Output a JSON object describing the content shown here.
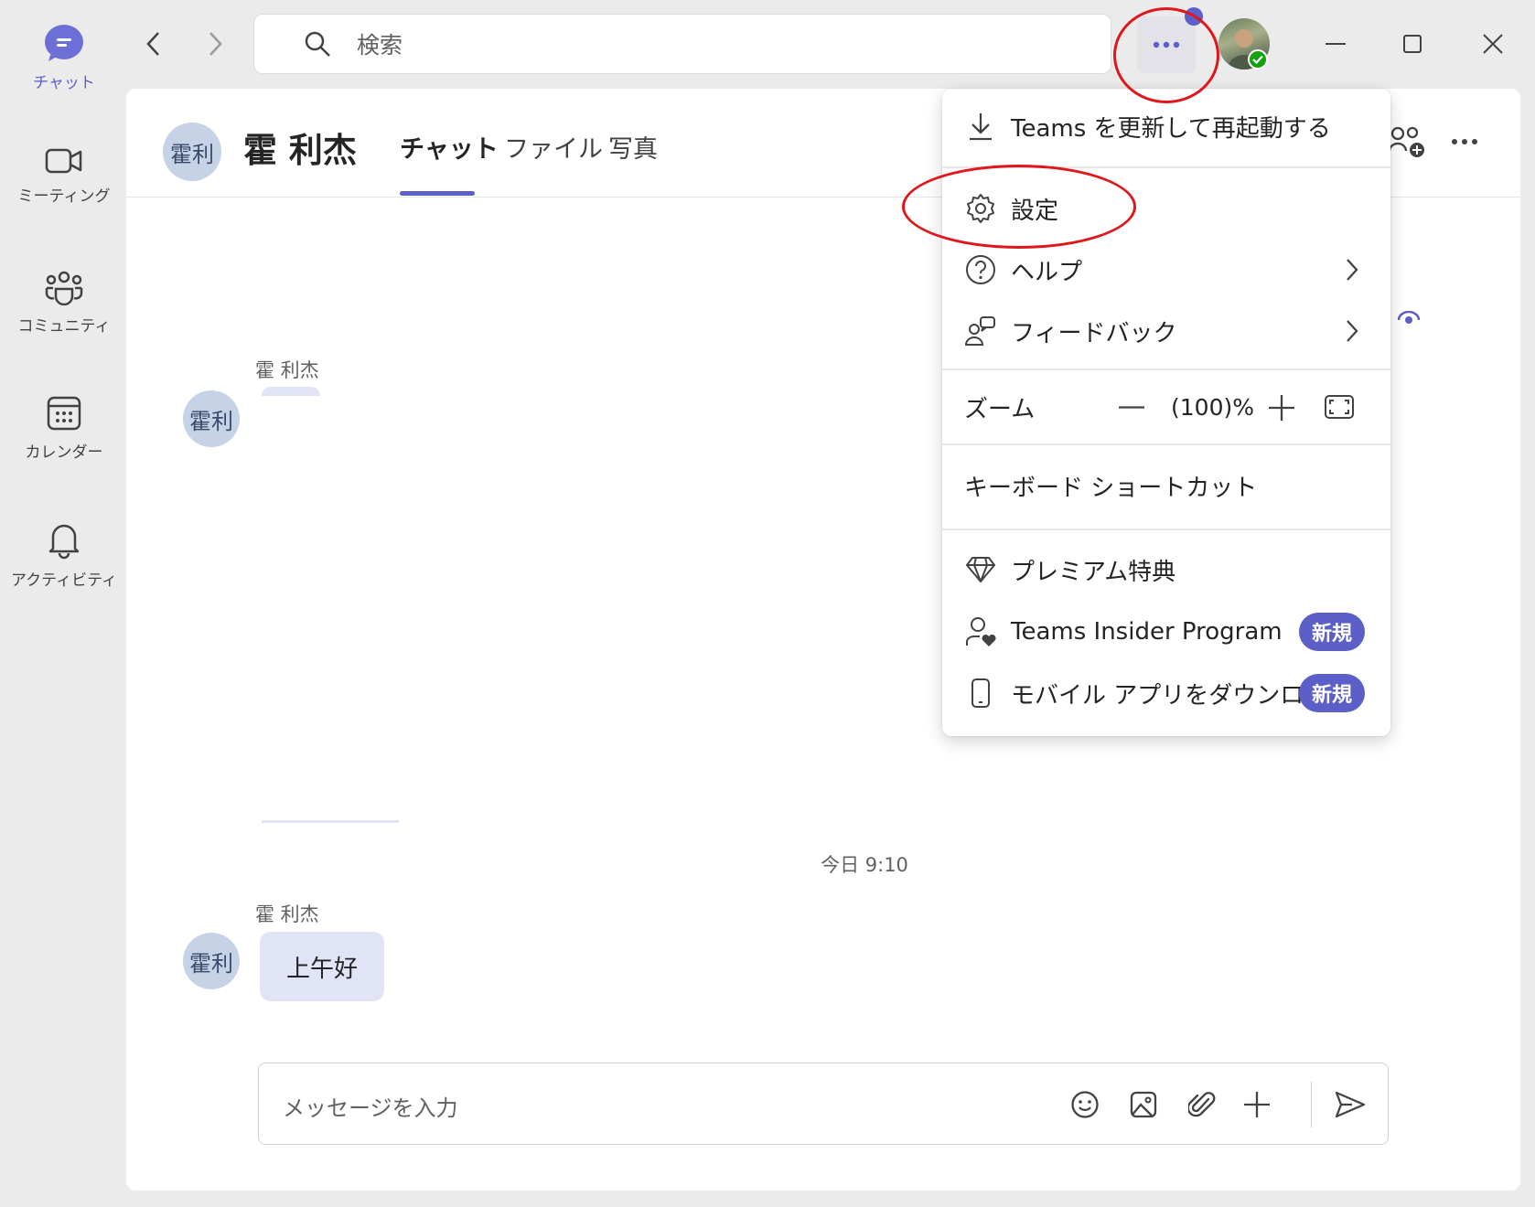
{
  "rail": {
    "items": [
      {
        "label": "チャット",
        "icon": "chat-icon",
        "active": true
      },
      {
        "label": "ミーティング",
        "icon": "video-icon"
      },
      {
        "label": "コミュニティ",
        "icon": "community-icon"
      },
      {
        "label": "カレンダー",
        "icon": "calendar-icon"
      },
      {
        "label": "アクティビティ",
        "icon": "bell-icon"
      }
    ]
  },
  "titlebar": {
    "search_placeholder": "検索"
  },
  "chat": {
    "avatar_initials": "霍利",
    "name": "霍 利杰",
    "tabs": [
      "チャット",
      "ファイル",
      "写真"
    ],
    "messages": [
      {
        "sender": "霍 利杰",
        "avatar": "霍利",
        "text": ""
      },
      {
        "sender": "霍 利杰",
        "avatar": "霍利",
        "text": "上午好"
      }
    ],
    "timestamp": "今日 9:10",
    "composer_placeholder": "メッセージを入力"
  },
  "menu": {
    "update": "Teams を更新して再起動する",
    "settings": "設定",
    "help": "ヘルプ",
    "feedback": "フィードバック",
    "zoom_label": "ズーム",
    "zoom_value": "(100)%",
    "shortcuts": "キーボード ショートカット",
    "premium": "プレミアム特典",
    "insider": "Teams Insider Program",
    "mobile": "モバイル アプリをダウンロード",
    "badge_new": "新規"
  },
  "colors": {
    "accent": "#5b5fc7",
    "annotation": "#e0161b",
    "bubble": "#e1e3f7"
  }
}
